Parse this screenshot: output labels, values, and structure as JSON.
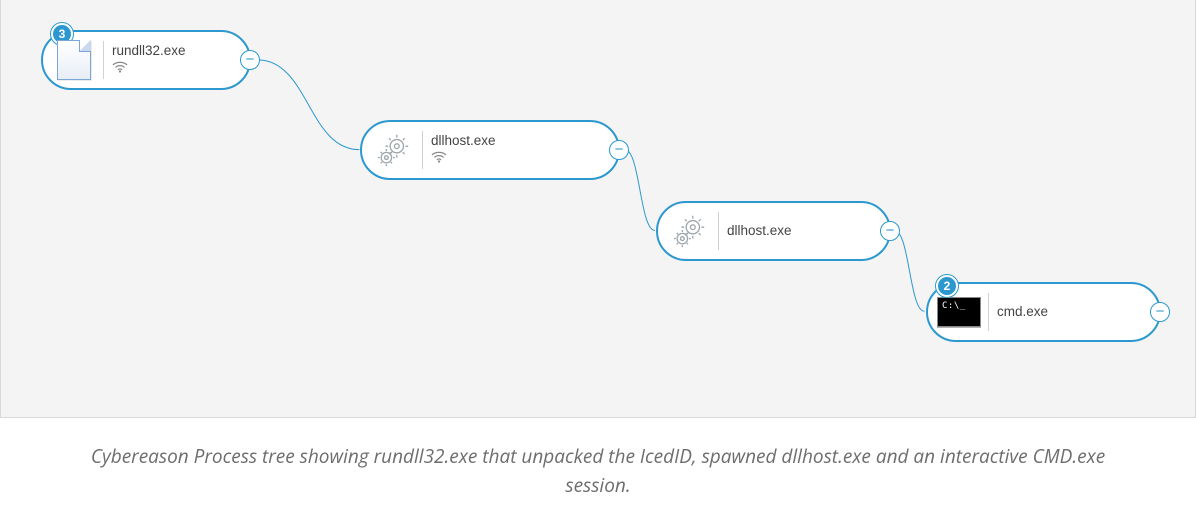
{
  "nodes": {
    "rundll32": {
      "label": "rundll32.exe",
      "badge": "3",
      "has_network": true
    },
    "dllhost1": {
      "label": "dllhost.exe",
      "has_network": true
    },
    "dllhost2": {
      "label": "dllhost.exe",
      "has_network": false
    },
    "cmd": {
      "label": "cmd.exe",
      "badge": "2",
      "has_network": false
    }
  },
  "collapse_glyph": "−",
  "caption": "Cybereason Process tree showing rundll32.exe that unpacked the IcedID, spawned dllhost.exe and an interactive CMD.exe session.",
  "colors": {
    "accent": "#2c98cf"
  }
}
